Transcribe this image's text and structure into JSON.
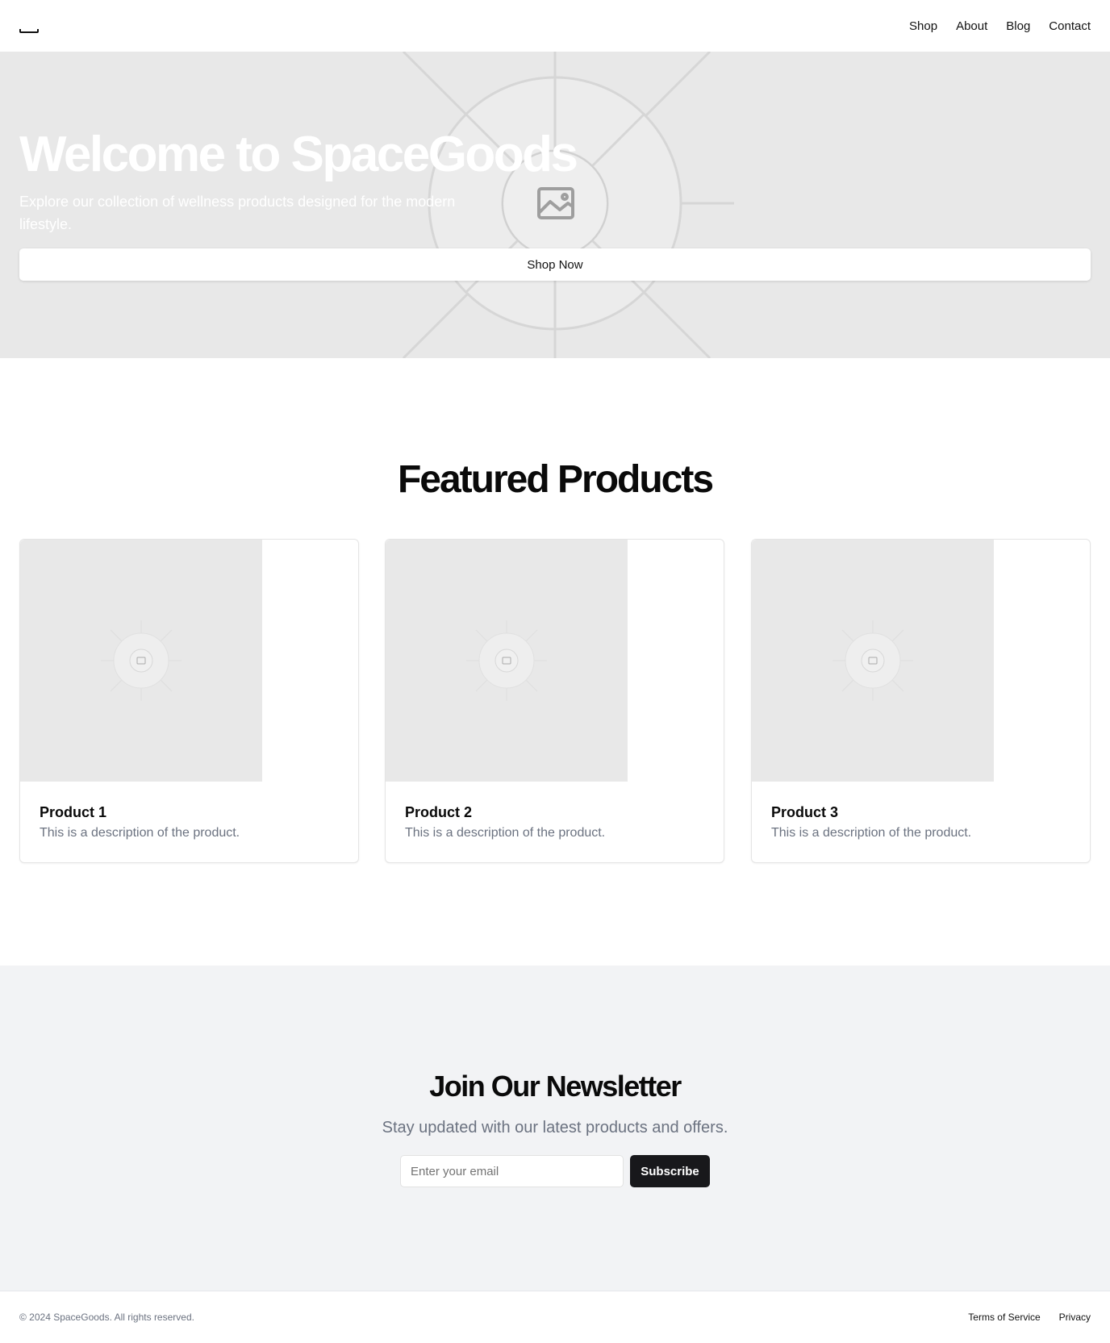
{
  "header": {
    "logo_icon": "logo-icon",
    "nav": [
      "Shop",
      "About",
      "Blog",
      "Contact"
    ]
  },
  "hero": {
    "title": "Welcome to SpaceGoods",
    "subtitle": "Explore our collection of wellness products designed for the modern lifestyle.",
    "cta_label": "Shop Now",
    "image_icon": "image-placeholder-icon",
    "background": "#e8e8e8"
  },
  "featured": {
    "title": "Featured Products",
    "products": [
      {
        "name": "Product 1",
        "description": "This is a description of the product."
      },
      {
        "name": "Product 2",
        "description": "This is a description of the product."
      },
      {
        "name": "Product 3",
        "description": "This is a description of the product."
      }
    ]
  },
  "newsletter": {
    "title": "Join Our Newsletter",
    "subtitle": "Stay updated with our latest products and offers.",
    "email_placeholder": "Enter your email",
    "subscribe_label": "Subscribe"
  },
  "footer": {
    "copyright": "© 2024 SpaceGoods. All rights reserved.",
    "links": [
      "Terms of Service",
      "Privacy"
    ]
  },
  "colors": {
    "primary_button": "#18181b",
    "muted_text": "#6b7280",
    "newsletter_bg": "#f2f3f5"
  }
}
